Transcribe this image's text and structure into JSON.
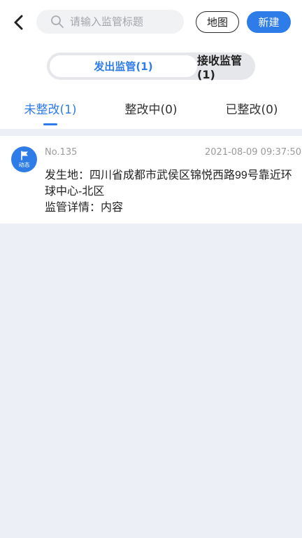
{
  "header": {
    "search_placeholder": "请输入监管标题",
    "map_label": "地图",
    "new_label": "新建"
  },
  "segment": {
    "options": [
      {
        "label": "发出监管(1)",
        "active": true
      },
      {
        "label": "接收监管(1)",
        "active": false
      }
    ]
  },
  "tabs": [
    {
      "label": "未整改(1)",
      "active": true
    },
    {
      "label": "整改中(0)",
      "active": false
    },
    {
      "label": "已整改(0)",
      "active": false
    }
  ],
  "items": [
    {
      "badge_text": "动态",
      "no": "No.135",
      "time": "2021-08-09 09:37:50",
      "address": "发生地：四川省成都市武侯区锦悦西路99号靠近环球中心-北区",
      "detail": "监管详情：内容"
    }
  ],
  "colors": {
    "accent": "#2e7ce8",
    "background": "#eceff5"
  }
}
